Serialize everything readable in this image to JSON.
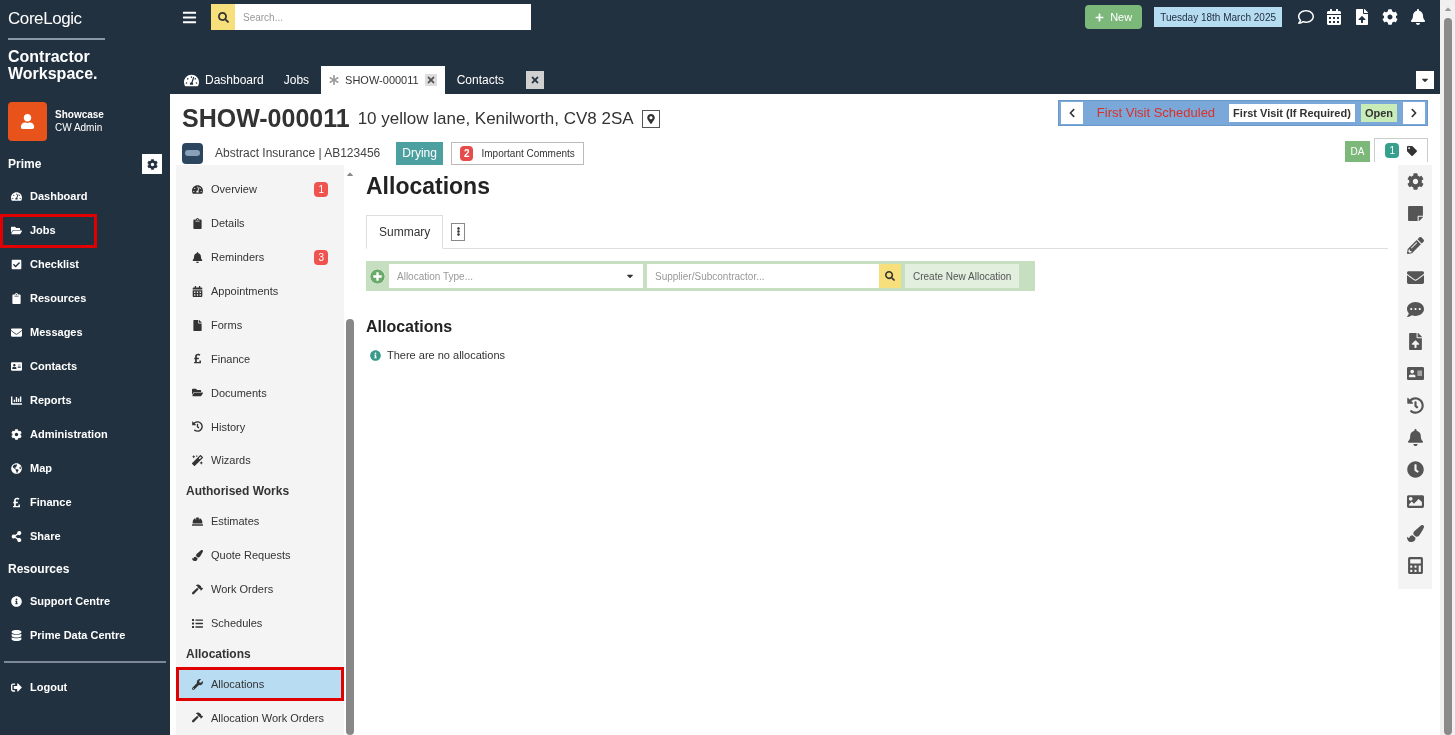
{
  "brand": {
    "logo": "CoreLogic",
    "product": [
      "Contractor",
      "Workspace."
    ]
  },
  "user": {
    "name": "Showcase",
    "role": "CW Admin"
  },
  "search": {
    "placeholder": "Search..."
  },
  "header": {
    "new_button": "New",
    "date": "Tuesday 18th March 2025"
  },
  "sidebar": [
    {
      "kind": "section",
      "label": "Prime"
    },
    {
      "kind": "item",
      "label": "Dashboard",
      "highlighted": false
    },
    {
      "kind": "item",
      "label": "Jobs",
      "highlighted": true
    },
    {
      "kind": "item",
      "label": "Checklist",
      "highlighted": false
    },
    {
      "kind": "item",
      "label": "Resources",
      "highlighted": false
    },
    {
      "kind": "item",
      "label": "Messages",
      "highlighted": false
    },
    {
      "kind": "item",
      "label": "Contacts",
      "highlighted": false
    },
    {
      "kind": "item",
      "label": "Reports",
      "highlighted": false
    },
    {
      "kind": "item",
      "label": "Administration",
      "highlighted": false
    },
    {
      "kind": "item",
      "label": "Map",
      "highlighted": false
    },
    {
      "kind": "item",
      "label": "Finance",
      "highlighted": false
    },
    {
      "kind": "item",
      "label": "Share",
      "highlighted": false
    },
    {
      "kind": "section",
      "label": "Resources"
    },
    {
      "kind": "item",
      "label": "Support Centre",
      "highlighted": false
    },
    {
      "kind": "item",
      "label": "Prime Data Centre",
      "highlighted": false
    },
    {
      "kind": "divider"
    },
    {
      "kind": "item",
      "label": "Logout",
      "highlighted": false
    }
  ],
  "tabs": [
    {
      "label": "Dashboard",
      "selected": false,
      "closable": false
    },
    {
      "label": "Jobs",
      "selected": false,
      "closable": false
    },
    {
      "label": "SHOW-000011",
      "selected": true,
      "closable": true
    },
    {
      "label": "Contacts",
      "selected": false,
      "closable": true
    }
  ],
  "job": {
    "id": "SHOW-000011",
    "address": "10 yellow lane, Kenilworth, CV8 2SA",
    "client": "Abstract Insurance | AB123456",
    "tag": "Drying",
    "comments_count": "2",
    "comments_label": "Important Comments"
  },
  "status": {
    "stage": "First Visit Scheduled",
    "step": "First Visit (If Required)",
    "state": "Open"
  },
  "corner": {
    "initials": "DA",
    "tag_count": "1"
  },
  "job_nav": [
    {
      "kind": "item",
      "label": "Overview",
      "badge": "1",
      "selected": false,
      "highlighted": false
    },
    {
      "kind": "item",
      "label": "Details",
      "selected": false,
      "highlighted": false
    },
    {
      "kind": "item",
      "label": "Reminders",
      "badge": "3",
      "selected": false,
      "highlighted": false
    },
    {
      "kind": "item",
      "label": "Appointments",
      "selected": false,
      "highlighted": false
    },
    {
      "kind": "item",
      "label": "Forms",
      "selected": false,
      "highlighted": false
    },
    {
      "kind": "item",
      "label": "Finance",
      "selected": false,
      "highlighted": false
    },
    {
      "kind": "item",
      "label": "Documents",
      "selected": false,
      "highlighted": false
    },
    {
      "kind": "item",
      "label": "History",
      "selected": false,
      "highlighted": false
    },
    {
      "kind": "item",
      "label": "Wizards",
      "selected": false,
      "highlighted": false
    },
    {
      "kind": "section",
      "label": "Authorised Works"
    },
    {
      "kind": "item",
      "label": "Estimates",
      "selected": false,
      "highlighted": false
    },
    {
      "kind": "item",
      "label": "Quote Requests",
      "selected": false,
      "highlighted": false
    },
    {
      "kind": "item",
      "label": "Work Orders",
      "selected": false,
      "highlighted": false
    },
    {
      "kind": "item",
      "label": "Schedules",
      "selected": false,
      "highlighted": false
    },
    {
      "kind": "section",
      "label": "Allocations"
    },
    {
      "kind": "item",
      "label": "Allocations",
      "selected": true,
      "highlighted": true
    },
    {
      "kind": "item",
      "label": "Allocation Work Orders",
      "selected": false,
      "highlighted": false
    }
  ],
  "main": {
    "title": "Allocations",
    "tabs": [
      {
        "label": "Summary",
        "selected": true
      }
    ],
    "allocation_type": {
      "placeholder": "Allocation Type..."
    },
    "supplier": {
      "placeholder": "Supplier/Subcontractor..."
    },
    "create_button": "Create New Allocation",
    "section_title": "Allocations",
    "empty_message": "There are no allocations"
  }
}
